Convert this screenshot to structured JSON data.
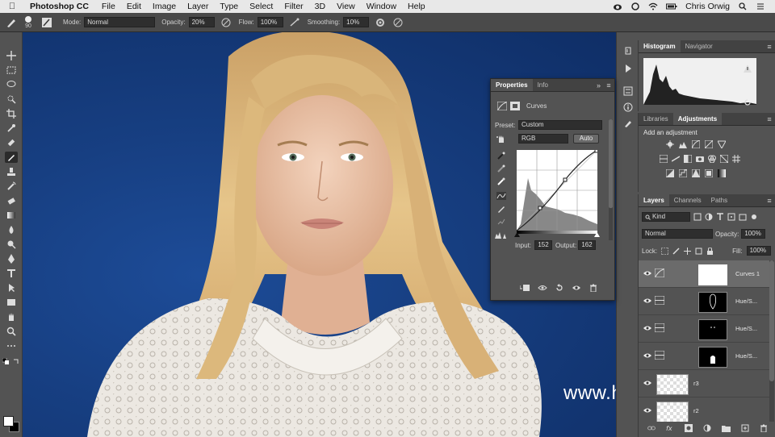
{
  "menubar": {
    "app_name": "Photoshop CC",
    "menus": [
      "File",
      "Edit",
      "Image",
      "Layer",
      "Type",
      "Select",
      "Filter",
      "3D",
      "View",
      "Window",
      "Help"
    ],
    "user": "Chris Orwig"
  },
  "options_bar": {
    "brush_size": "90",
    "mode_label": "Mode:",
    "mode_value": "Normal",
    "opacity_label": "Opacity:",
    "opacity_value": "20%",
    "flow_label": "Flow:",
    "flow_value": "100%",
    "smoothing_label": "Smoothing:",
    "smoothing_value": "10%"
  },
  "properties_panel": {
    "tabs": [
      "Properties",
      "Info"
    ],
    "adjustment_name": "Curves",
    "preset_label": "Preset:",
    "preset_value": "Custom",
    "channel_value": "RGB",
    "auto_label": "Auto",
    "input_label": "Input:",
    "input_value": "152",
    "output_label": "Output:",
    "output_value": "162"
  },
  "histogram_panel": {
    "tabs": [
      "Histogram",
      "Navigator"
    ]
  },
  "adjustments_panel": {
    "tabs": [
      "Libraries",
      "Adjustments"
    ],
    "heading": "Add an adjustment"
  },
  "layers_panel": {
    "tabs": [
      "Layers",
      "Channels",
      "Paths"
    ],
    "filter_kind": "Kind",
    "blend_mode": "Normal",
    "opacity_label": "Opacity:",
    "opacity_value": "100%",
    "lock_label": "Lock:",
    "fill_label": "Fill:",
    "fill_value": "100%",
    "layers": [
      {
        "name": "Curves 1",
        "active": true
      },
      {
        "name": "Hue/S..."
      },
      {
        "name": "Hue/S..."
      },
      {
        "name": "Hue/S..."
      },
      {
        "name": "r3"
      },
      {
        "name": "r2"
      }
    ]
  },
  "watermark": "www.hunls.com",
  "colors": {
    "panel_bg": "#535353",
    "canvas_bg": "#173f82",
    "active_tab": "#535353",
    "active_layer": "#6b6b6b"
  }
}
